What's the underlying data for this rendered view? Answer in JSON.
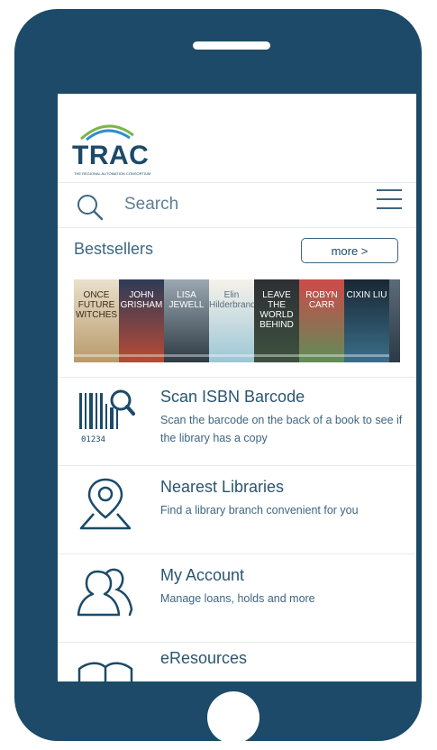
{
  "logo": {
    "wordmark": "TRAC",
    "tagline": "THE REGIONAL AUTOMATION CONSORTIUM"
  },
  "search": {
    "placeholder": "Search"
  },
  "bestsellers": {
    "heading": "Bestsellers",
    "more_label": "more >",
    "covers": [
      {
        "text": "ONCE FUTURE WITCHES"
      },
      {
        "text": "JOHN GRISHAM"
      },
      {
        "text": "LISA JEWELL"
      },
      {
        "text": "Elin Hilderbrand"
      },
      {
        "text": "LEAVE THE WORLD BEHIND"
      },
      {
        "text": "ROBYN CARR"
      },
      {
        "text": "CIXIN LIU"
      },
      {
        "text": ""
      }
    ]
  },
  "menu": [
    {
      "title": "Scan ISBN Barcode",
      "desc": "Scan the barcode on the back of a book to see if the library has a copy",
      "barcode_digits": "01234"
    },
    {
      "title": "Nearest Libraries",
      "desc": "Find a library branch convenient for you"
    },
    {
      "title": "My Account",
      "desc": "Manage loans, holds and more"
    },
    {
      "title": "eResources",
      "desc": ""
    }
  ],
  "colors": {
    "frame": "#1c4a68",
    "text": "#3e6680",
    "title": "#2a5570",
    "arc_green": "#7ab648",
    "arc_blue": "#2f8fcf"
  }
}
